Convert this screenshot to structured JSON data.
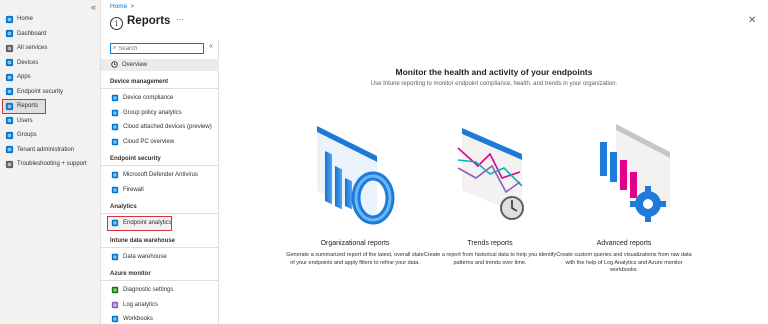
{
  "leftnav": {
    "collapse_glyph": "«",
    "items": [
      {
        "label": "Home",
        "icon": "home-icon",
        "color": "#0078d4"
      },
      {
        "label": "Dashboard",
        "icon": "dashboard-icon",
        "color": "#0078d4"
      },
      {
        "label": "All services",
        "icon": "all-services-icon",
        "color": "#605e5c"
      },
      {
        "label": "Devices",
        "icon": "devices-icon",
        "color": "#0078d4"
      },
      {
        "label": "Apps",
        "icon": "apps-icon",
        "color": "#0078d4"
      },
      {
        "label": "Endpoint security",
        "icon": "endpoint-security-icon",
        "color": "#0078d4"
      },
      {
        "label": "Reports",
        "icon": "reports-icon",
        "color": "#0078d4",
        "selected": true
      },
      {
        "label": "Users",
        "icon": "users-icon",
        "color": "#0078d4"
      },
      {
        "label": "Groups",
        "icon": "groups-icon",
        "color": "#0078d4"
      },
      {
        "label": "Tenant administration",
        "icon": "tenant-admin-icon",
        "color": "#0078d4"
      },
      {
        "label": "Troubleshooting + support",
        "icon": "troubleshooting-icon",
        "color": "#605e5c"
      }
    ]
  },
  "header": {
    "breadcrumb": "Home",
    "breadcrumb_sep": ">",
    "title": "Reports",
    "title_icon_glyph": "i",
    "more_glyph": "···",
    "close_glyph": "✕"
  },
  "menu": {
    "search_placeholder": "Search",
    "search_icon_glyph": "⌕",
    "collapse_glyph": "«",
    "overview_label": "Overview",
    "overview_icon_glyph": "⓪",
    "sections": [
      {
        "title": "Device management",
        "items": [
          {
            "label": "Device compliance",
            "icon": "device-compliance-icon",
            "color": "#0078d4"
          },
          {
            "label": "Group policy analytics",
            "icon": "group-policy-icon",
            "color": "#0078d4"
          },
          {
            "label": "Cloud attached devices (preview)",
            "icon": "cloud-attached-icon",
            "color": "#0078d4"
          },
          {
            "label": "Cloud PC overview",
            "icon": "cloud-pc-icon",
            "color": "#0078d4"
          }
        ]
      },
      {
        "title": "Endpoint security",
        "items": [
          {
            "label": "Microsoft Defender Antivirus",
            "icon": "defender-icon",
            "color": "#0078d4"
          },
          {
            "label": "Firewall",
            "icon": "firewall-icon",
            "color": "#0078d4"
          }
        ]
      },
      {
        "title": "Analytics",
        "items": [
          {
            "label": "Endpoint analytics",
            "icon": "endpoint-analytics-icon",
            "color": "#0078d4",
            "selected": true
          }
        ]
      },
      {
        "title": "Intune data warehouse",
        "items": [
          {
            "label": "Data warehouse",
            "icon": "data-warehouse-icon",
            "color": "#0078d4"
          }
        ]
      },
      {
        "title": "Azure monitor",
        "items": [
          {
            "label": "Diagnostic settings",
            "icon": "diagnostic-settings-icon",
            "color": "#107c10"
          },
          {
            "label": "Log analytics",
            "icon": "log-analytics-icon",
            "color": "#8764b8"
          },
          {
            "label": "Workbooks",
            "icon": "workbooks-icon",
            "color": "#0078d4"
          }
        ]
      }
    ]
  },
  "main": {
    "hero_title": "Monitor the health and activity of your endpoints",
    "hero_subtitle": "Use Intune reporting to monitor endpoint compliance, health, and trends in your organization.",
    "cards": [
      {
        "title": "Organizational reports",
        "description": "Generate a summarized report of the latest, overall state of your endpoints and apply filters to refine your data.",
        "illustration": "bar-chart-illustration"
      },
      {
        "title": "Trends reports",
        "description": "Create a report from historical data to help you identify patterns and trends over time.",
        "illustration": "line-chart-clock-illustration"
      },
      {
        "title": "Advanced reports",
        "description": "Create custom queries and visualizations from raw data with the help of Log Analytics and Azure monitor workbooks.",
        "illustration": "bar-chart-gear-illustration"
      }
    ]
  },
  "colors": {
    "accent": "#0078d4",
    "selection_outline": "#d13438",
    "nav_bg": "#f3f2f1"
  }
}
